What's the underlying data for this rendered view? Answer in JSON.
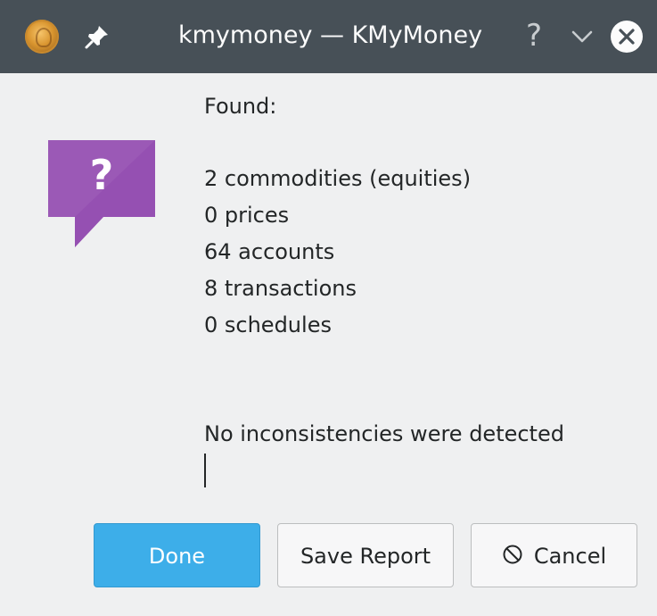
{
  "window": {
    "title": "kmymoney — KMyMoney",
    "icons": [
      "kmymoney-app-icon",
      "pin-icon",
      "help-icon",
      "minimize-icon",
      "close-icon"
    ],
    "help_glyph": "?"
  },
  "dialog": {
    "icon": "question-icon",
    "found_label": "Found:",
    "stats": [
      "2 commodities (equities)",
      "0 prices",
      "64 accounts",
      "8 transactions",
      "0 schedules"
    ],
    "result": "No inconsistencies were detected"
  },
  "buttons": {
    "done": "Done",
    "save_report": "Save Report",
    "cancel": "Cancel"
  },
  "colors": {
    "titlebar": "#475057",
    "background": "#eff0f1",
    "accent": "#3daee9",
    "question_icon": "#9b59b6"
  }
}
